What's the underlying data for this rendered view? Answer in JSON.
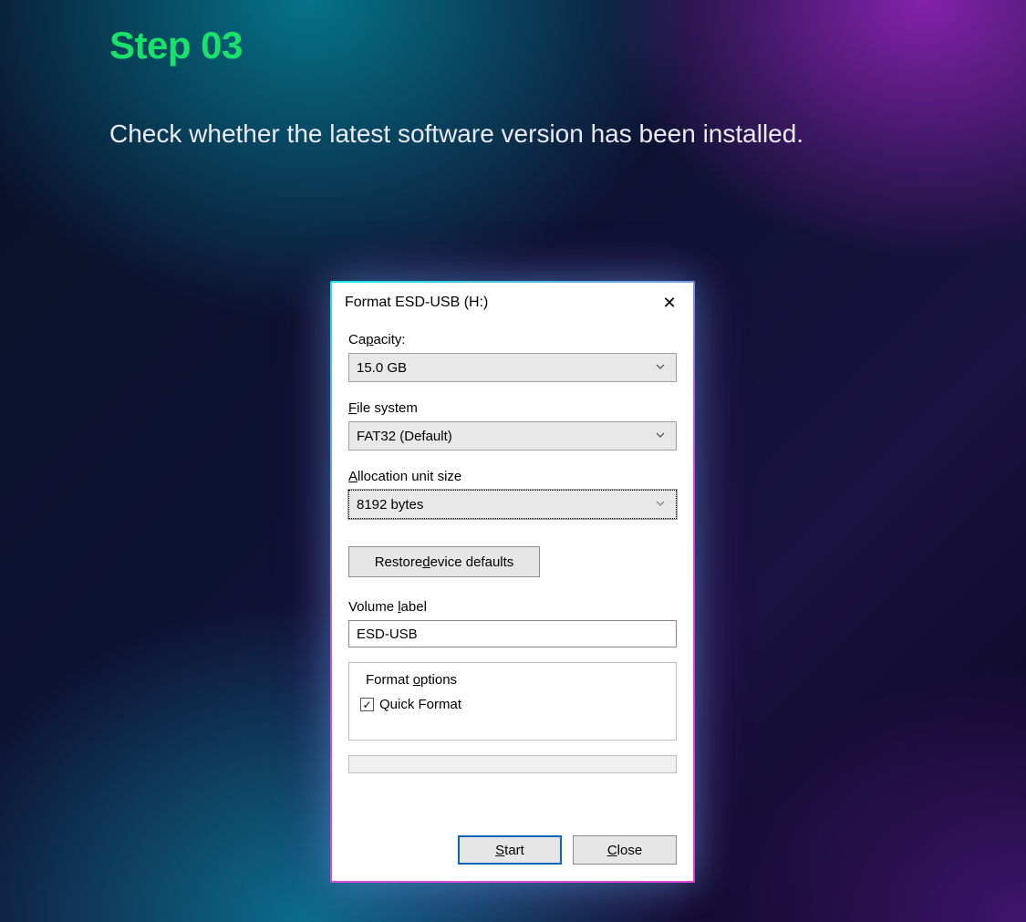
{
  "page": {
    "step_title": "Step 03",
    "step_description": "Check whether the latest software version has been installed."
  },
  "dialog": {
    "title": "Format ESD-USB (H:)",
    "capacity": {
      "label_pre": "Ca",
      "label_u": "p",
      "label_post": "acity:",
      "value": "15.0 GB"
    },
    "filesystem": {
      "label_u": "F",
      "label_post": "ile system",
      "value": "FAT32 (Default)"
    },
    "allocation": {
      "label_u": "A",
      "label_post": "llocation unit size",
      "value": "8192 bytes"
    },
    "restore": {
      "pre": "Restore ",
      "u": "d",
      "post": "evice defaults"
    },
    "volume": {
      "label_pre": "Volume ",
      "label_u": "l",
      "label_post": "abel",
      "value": "ESD-USB"
    },
    "format_options": {
      "legend_pre": "Format ",
      "legend_u": "o",
      "legend_post": "ptions",
      "quick": "Quick Format",
      "quick_checked": true
    },
    "buttons": {
      "start_u": "S",
      "start_post": "tart",
      "close_u": "C",
      "close_post": "lose"
    }
  }
}
